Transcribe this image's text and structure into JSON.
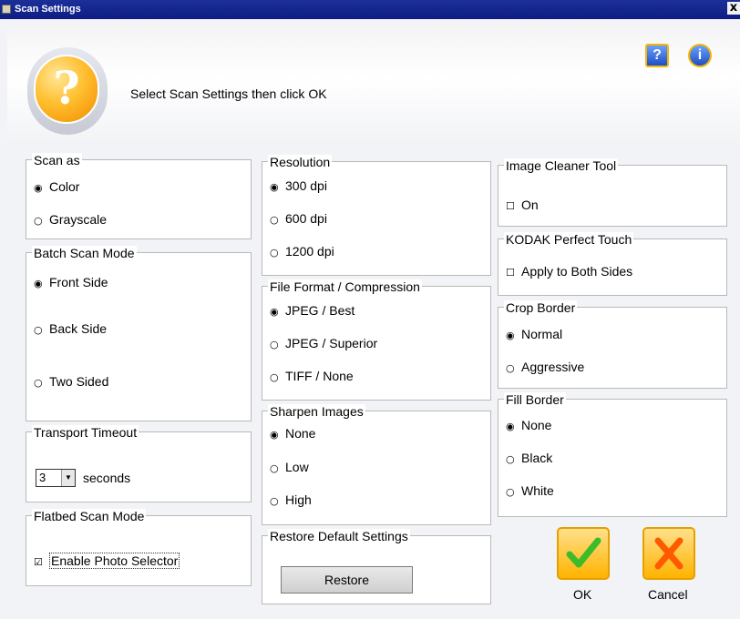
{
  "window": {
    "title": "Scan Settings",
    "close_glyph": "x"
  },
  "header": {
    "instruction": "Select Scan Settings then click OK",
    "question_glyph": "?",
    "help_glyph": "?",
    "info_glyph": "i"
  },
  "groups": {
    "scan_as": {
      "label": "Scan as",
      "options": [
        "Color",
        "Grayscale"
      ],
      "selected": "Color"
    },
    "batch_scan_mode": {
      "label": "Batch Scan Mode",
      "options": [
        "Front Side",
        "Back Side",
        "Two Sided"
      ],
      "selected": "Front Side"
    },
    "transport_timeout": {
      "label": "Transport Timeout",
      "value": "3",
      "unit": "seconds"
    },
    "flatbed_scan_mode": {
      "label": "Flatbed Scan Mode",
      "checkbox_label": "Enable Photo Selector",
      "checked": true
    },
    "resolution": {
      "label": "Resolution",
      "options": [
        "300 dpi",
        "600 dpi",
        "1200 dpi"
      ],
      "selected": "300 dpi"
    },
    "file_format": {
      "label": "File Format / Compression",
      "options": [
        "JPEG / Best",
        "JPEG / Superior",
        "TIFF / None"
      ],
      "selected": "JPEG / Best"
    },
    "sharpen_images": {
      "label": "Sharpen Images",
      "options": [
        "None",
        "Low",
        "High"
      ],
      "selected": "None"
    },
    "restore_defaults": {
      "label": "Restore Default Settings",
      "button_label": "Restore"
    },
    "image_cleaner": {
      "label": "Image Cleaner Tool",
      "checkbox_label": "On",
      "checked": false
    },
    "kodak_perfect_touch": {
      "label": "KODAK Perfect Touch",
      "checkbox_label": "Apply to Both Sides",
      "checked": false
    },
    "crop_border": {
      "label": "Crop Border",
      "options": [
        "Normal",
        "Aggressive"
      ],
      "selected": "Normal"
    },
    "fill_border": {
      "label": "Fill Border",
      "options": [
        "None",
        "Black",
        "White"
      ],
      "selected": "None"
    }
  },
  "actions": {
    "ok_label": "OK",
    "cancel_label": "Cancel"
  },
  "glyphs": {
    "radio_on": "◉",
    "radio_off": "○",
    "check_on": "☑",
    "check_off": "☐",
    "dropdown": "▼"
  },
  "colors": {
    "accent_orange": "#ffb300",
    "ok_green": "#3dbb2a",
    "cancel_orange": "#ff5a00",
    "title_bar": "#0d1d83"
  }
}
